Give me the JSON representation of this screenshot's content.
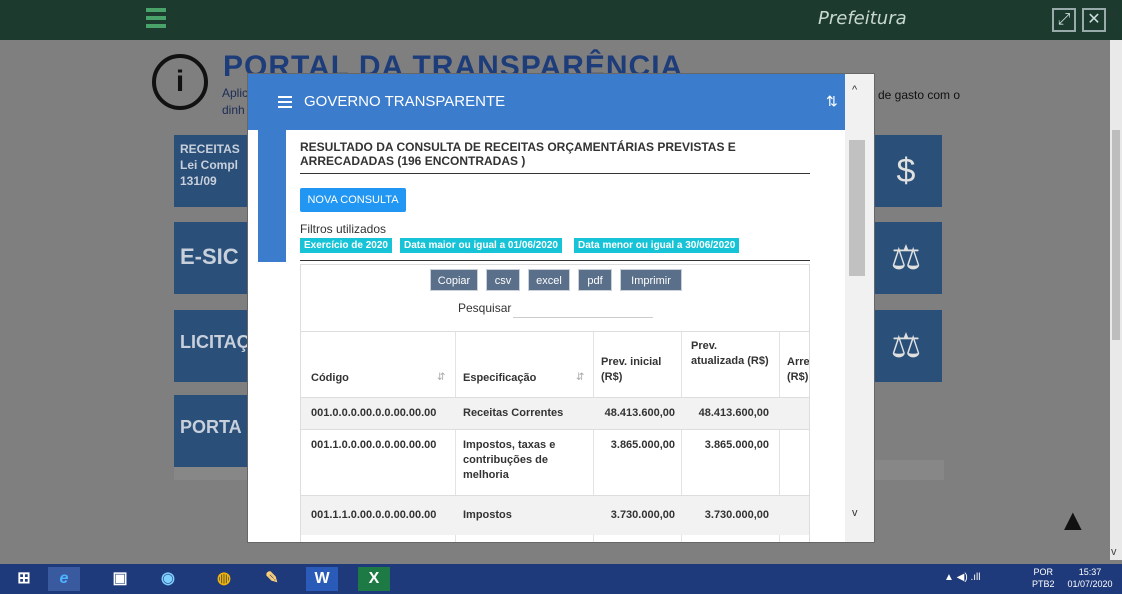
{
  "topbar": {
    "brand": "Prefeitura",
    "fullscreen_symbol": "⤢",
    "close_symbol": "✕",
    "scroll_up_symbol": "^"
  },
  "background": {
    "logo_symbol": "i",
    "portal_title": "PORTAL DA TRANSPARÊNCIA",
    "subtitle_line1": "Aplic",
    "subtitle_line2": "dinh",
    "right_text": "de gasto com o",
    "cards": {
      "receitas": "RECEITAS Lei Compl 131/09",
      "esic": "E-SIC",
      "licitacoes": "LICITAÇ",
      "portal": "PORTA"
    },
    "right_icons": [
      "money-bag-icon",
      "scale-weight-icon",
      "justice-scale-icon"
    ],
    "scroll_to_top_symbol": "▲"
  },
  "modal": {
    "title": "GOVERNO TRANSPARENTE",
    "sort_symbol": "⇅",
    "result_title": "RESULTADO DA CONSULTA DE RECEITAS ORÇAMENTÁRIAS PREVISTAS E ARRECADADAS (196 ENCONTRADAS )",
    "new_query_label": "NOVA CONSULTA",
    "filters_label": "Filtros utilizados",
    "filters": [
      "Exercício de 2020",
      "Data maior ou igual a 01/06/2020",
      "Data menor ou igual a 30/06/2020"
    ],
    "export_buttons": [
      "Copiar",
      "csv",
      "excel",
      "pdf",
      "Imprimir"
    ],
    "search_label": "Pesquisar",
    "search_value": "",
    "columns": [
      "Código",
      "Especificação",
      "Prev. inicial (R$)",
      "Prev. atualizada (R$)",
      "Arre (R$)"
    ],
    "rows": [
      {
        "codigo": "001.0.0.0.00.0.0.00.00.00",
        "especificacao": "Receitas Correntes",
        "prev_inicial": "48.413.600,00",
        "prev_atualizada": "48.413.600,00"
      },
      {
        "codigo": "001.1.0.0.00.0.0.00.00.00",
        "especificacao": "Impostos, taxas e contribuções de melhoria",
        "prev_inicial": "3.865.000,00",
        "prev_atualizada": "3.865.000,00"
      },
      {
        "codigo": "001.1.1.0.00.0.0.00.00.00",
        "especificacao": "Impostos",
        "prev_inicial": "3.730.000,00",
        "prev_atualizada": "3.730.000,00"
      }
    ],
    "scroll_up_symbol": "^",
    "scroll_down_symbol": "v"
  },
  "taskbar": {
    "apps": [
      "start-button",
      "internet-explorer-icon",
      "store-icon",
      "media-icon",
      "chrome-icon",
      "paint-icon",
      "word-icon",
      "excel-icon"
    ],
    "tray_symbols": "▲  ◀)  .ıll",
    "lang_line1": "POR",
    "lang_line2": "PTB2",
    "time": "15:37",
    "date": "01/07/2020"
  },
  "colors": {
    "modal_header": "#3b7ccc",
    "chip": "#17c3d6",
    "primary_button": "#2196f3",
    "taskbar": "#1f3a7a"
  }
}
